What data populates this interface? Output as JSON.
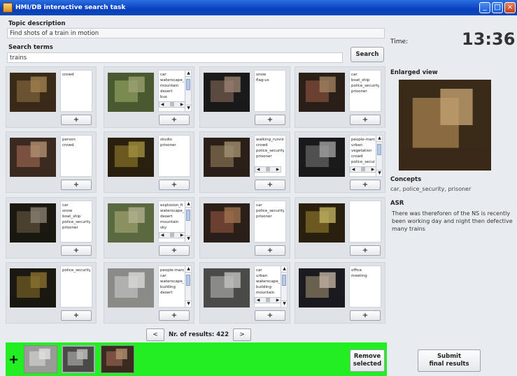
{
  "window": {
    "title": "HMI/DB interactive search task"
  },
  "topic": {
    "label": "Topic description",
    "value": "Find shots of a train in motion"
  },
  "search": {
    "label": "Search terms",
    "value": "trains",
    "button": "Search"
  },
  "timer": {
    "label": "Time:",
    "value": "13:36"
  },
  "results": {
    "prev": "<",
    "next": ">",
    "count_text": "Nr. of results: 422",
    "add_label": "+",
    "items": [
      {
        "concepts": [
          "crowd"
        ],
        "scroll": false,
        "palette": [
          "#3a2a18",
          "#6b5230",
          "#a08050"
        ]
      },
      {
        "concepts": [
          "car",
          "waterscape_",
          "mountain",
          "desert",
          "bus"
        ],
        "scroll": true,
        "hscroll": true,
        "palette": [
          "#4a5a30",
          "#7a8a50",
          "#9aa070"
        ]
      },
      {
        "concepts": [
          "snow",
          "flag-us"
        ],
        "scroll": false,
        "palette": [
          "#1a1a1a",
          "#5a4a40",
          "#9a8070"
        ]
      },
      {
        "concepts": [
          "car",
          "boat_ship",
          "police_security",
          "prisoner"
        ],
        "scroll": false,
        "palette": [
          "#2a2018",
          "#6a4030",
          "#a08060"
        ]
      },
      {
        "concepts": [
          "person",
          "crowd"
        ],
        "scroll": false,
        "palette": [
          "#3a2a20",
          "#7a5040",
          "#b09070"
        ]
      },
      {
        "concepts": [
          "studio",
          "prisoner"
        ],
        "scroll": false,
        "palette": [
          "#2a2010",
          "#6a5a20",
          "#a09040"
        ]
      },
      {
        "concepts": [
          "walking_running",
          "crowd",
          "police_security",
          "prisoner"
        ],
        "scroll": false,
        "hscroll": true,
        "palette": [
          "#2a2018",
          "#6a5840",
          "#a09070"
        ]
      },
      {
        "concepts": [
          "people-marc",
          "urban",
          "vegetation",
          "crowd",
          "police_secur"
        ],
        "scroll": true,
        "hscroll": true,
        "palette": [
          "#1a1a1a",
          "#505050",
          "#a0a0a0"
        ]
      },
      {
        "concepts": [
          "car",
          "snow",
          "boat_ship",
          "police_security",
          "prisoner"
        ],
        "scroll": false,
        "palette": [
          "#1a1810",
          "#4a4030",
          "#8a8070"
        ]
      },
      {
        "concepts": [
          "explosion_fi",
          "waterscape_",
          "desert",
          "mountain",
          "sky"
        ],
        "scroll": true,
        "hscroll": true,
        "palette": [
          "#5a6a40",
          "#8a9060",
          "#b0b090"
        ]
      },
      {
        "concepts": [
          "car",
          "police_security",
          "prisoner"
        ],
        "scroll": false,
        "palette": [
          "#2a2018",
          "#6a4030",
          "#a07050"
        ]
      },
      {
        "concepts": [],
        "scroll": false,
        "palette": [
          "#2a2010",
          "#6a5a20",
          "#c0b060"
        ]
      },
      {
        "concepts": [
          "police_security"
        ],
        "scroll": false,
        "palette": [
          "#1a1810",
          "#5a4a20",
          "#8a7030"
        ]
      },
      {
        "concepts": [
          "people-marc",
          "car",
          "waterscape_",
          "building",
          "desert"
        ],
        "scroll": true,
        "palette": [
          "#8a8a88",
          "#b0b0ae",
          "#d8d8d6"
        ]
      },
      {
        "concepts": [
          "car",
          "urban",
          "waterscape_",
          "building",
          "mountain"
        ],
        "scroll": true,
        "hscroll": true,
        "palette": [
          "#4a4a48",
          "#8a8a88",
          "#c0c0be"
        ]
      },
      {
        "concepts": [
          "office",
          "meeting"
        ],
        "scroll": false,
        "palette": [
          "#1a1a20",
          "#6a6050",
          "#c0b0a0"
        ]
      }
    ]
  },
  "enlarged": {
    "label": "Enlarged view",
    "palette": [
      "#3a2a18",
      "#8a6a40",
      "#c0a070"
    ]
  },
  "concepts_panel": {
    "label": "Concepts",
    "value": "car, police_security, prisoner"
  },
  "asr": {
    "label": "ASR",
    "text": "There was thereforen of the NS is recently been working day and night then defective many trains"
  },
  "selection": {
    "plus": "+",
    "thumbs": [
      {
        "palette": [
          "#9a9a98",
          "#c0c0be",
          "#e0e0de"
        ]
      },
      {
        "palette": [
          "#4a4a48",
          "#8a8a88",
          "#c0c0be"
        ]
      },
      {
        "palette": [
          "#3a2a20",
          "#7a5040",
          "#b09070"
        ]
      }
    ],
    "remove_line1": "Remove",
    "remove_line2": "selected"
  },
  "submit": {
    "line1": "Submit",
    "line2": "final results"
  },
  "colors": {
    "selection_bar": "#22ef22",
    "titlebar": "#0a3fbf"
  }
}
